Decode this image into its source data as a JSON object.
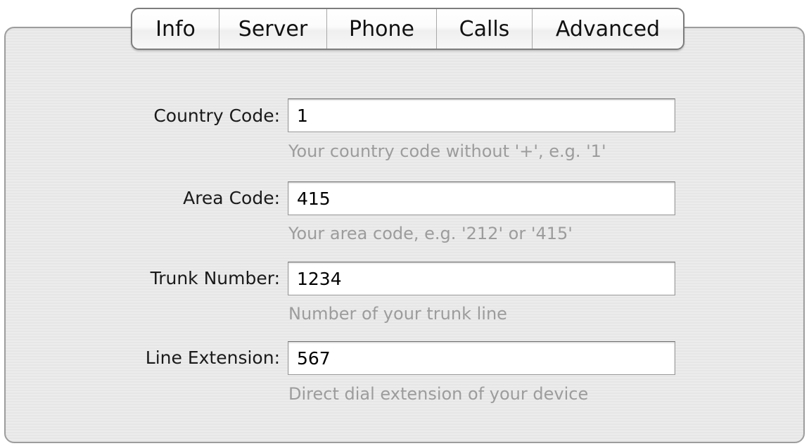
{
  "tabs": [
    {
      "label": "Info"
    },
    {
      "label": "Server"
    },
    {
      "label": "Phone"
    },
    {
      "label": "Calls"
    },
    {
      "label": "Advanced"
    }
  ],
  "selected_tab": "Phone",
  "form": {
    "country_code": {
      "label": "Country Code:",
      "value": "1",
      "hint": "Your country code without '+', e.g. '1'"
    },
    "area_code": {
      "label": "Area Code:",
      "value": "415",
      "hint": "Your area code, e.g. '212' or '415'"
    },
    "trunk_number": {
      "label": "Trunk Number:",
      "value": "1234",
      "hint": "Number of your trunk line"
    },
    "line_extension": {
      "label": "Line Extension:",
      "value": "567",
      "hint": "Direct dial extension of your device"
    }
  }
}
